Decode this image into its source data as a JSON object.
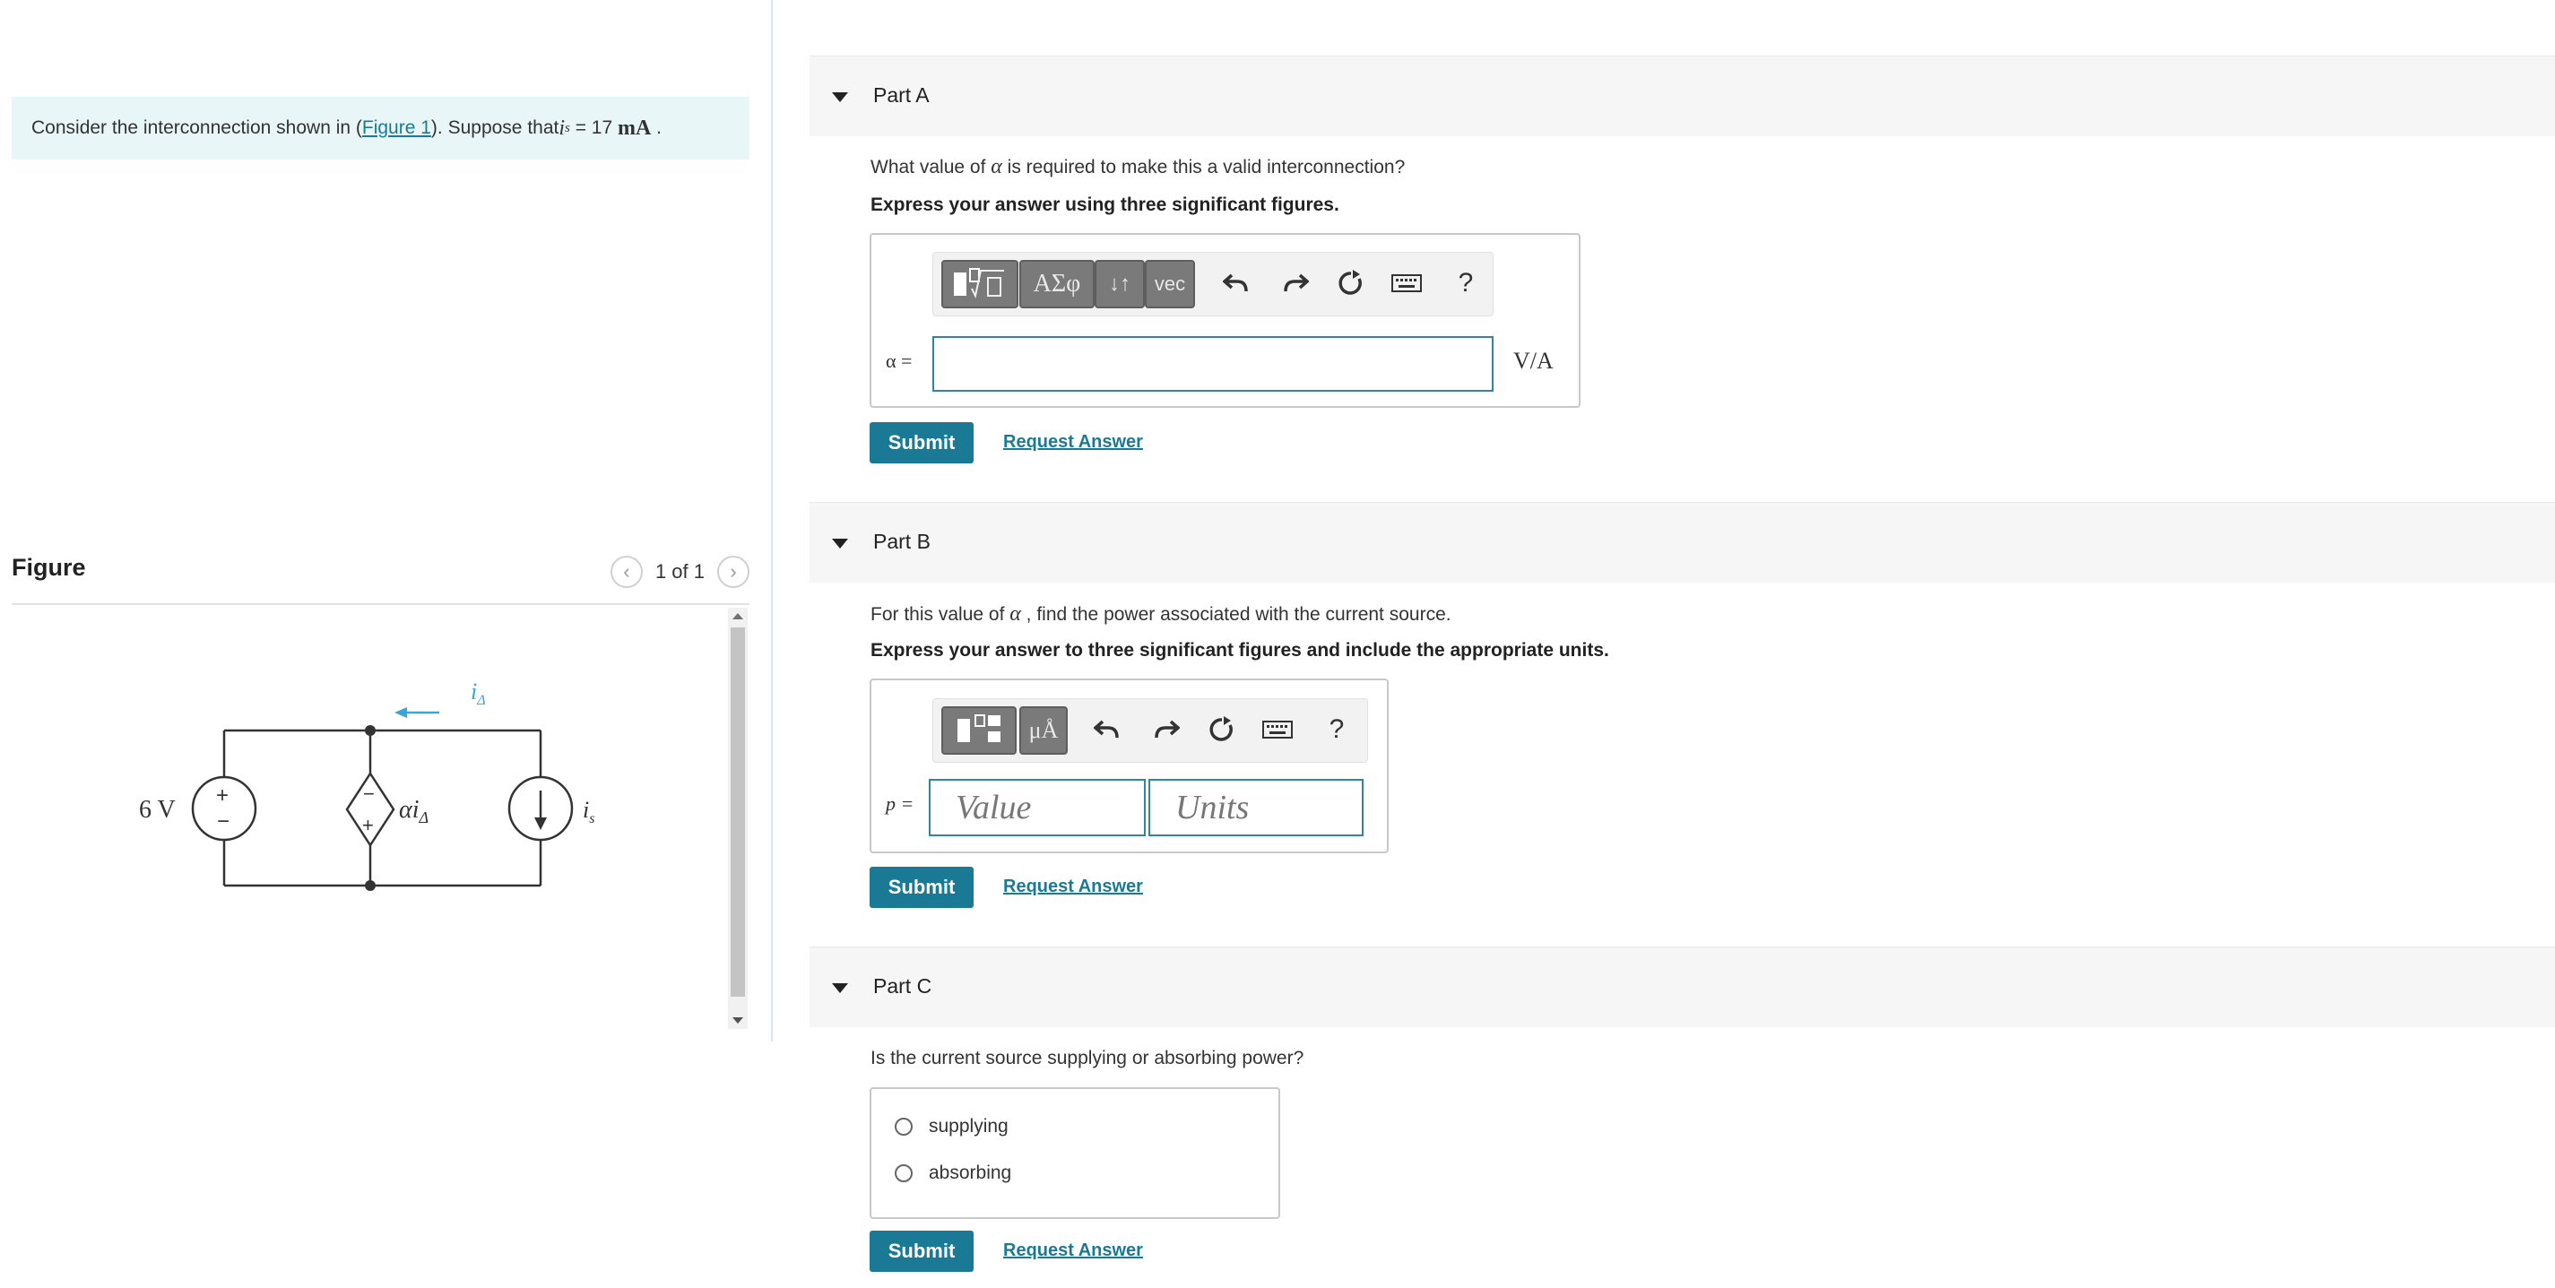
{
  "problem": {
    "text_before": "Consider the interconnection shown in (",
    "figure_link": "Figure 1",
    "text_after": "). Suppose that ",
    "var": "i",
    "var_sub": "s",
    "equals": " = 17 ",
    "unit": "mA",
    "end": " ."
  },
  "figure": {
    "title": "Figure",
    "pager": "1 of 1",
    "prev_icon": "chevron-left-icon",
    "next_icon": "chevron-right-icon",
    "circuit": {
      "source_label": "6 V",
      "plus": "+",
      "minus": "−",
      "dependent_label": "αi",
      "dependent_sub": "Δ",
      "current_label": "i",
      "current_sub": "Δ",
      "is_label": "i",
      "is_sub": "s"
    }
  },
  "partA": {
    "label": "Part A",
    "question_before": "What value of ",
    "question_symbol": "α",
    "question_after": " is required to make this a valid interconnection?",
    "instruction": "Express your answer using three significant figures.",
    "toolbar": [
      "template-icon",
      "ΑΣφ",
      "↓↑",
      "vec",
      "undo-icon",
      "redo-icon",
      "reset-icon",
      "keyboard-icon",
      "?"
    ],
    "btn_greek": "ΑΣφ",
    "btn_arrows": "↓↑",
    "btn_vec": "vec",
    "help": "?",
    "var_label": "α =",
    "input_value": "",
    "unit": "V/A",
    "submit": "Submit",
    "request": "Request Answer"
  },
  "partB": {
    "label": "Part B",
    "question_before": "For this value of ",
    "question_symbol": "α",
    "question_after": " , find the power associated with the current source.",
    "instruction": "Express your answer to three significant figures and include the appropriate units.",
    "btn_units": "μÅ",
    "help": "?",
    "var_label": "p =",
    "value_placeholder": "Value",
    "units_placeholder": "Units",
    "submit": "Submit",
    "request": "Request Answer"
  },
  "partC": {
    "label": "Part C",
    "question": "Is the current source supplying or absorbing power?",
    "options": [
      "supplying",
      "absorbing"
    ],
    "submit": "Submit",
    "request": "Request Answer"
  }
}
